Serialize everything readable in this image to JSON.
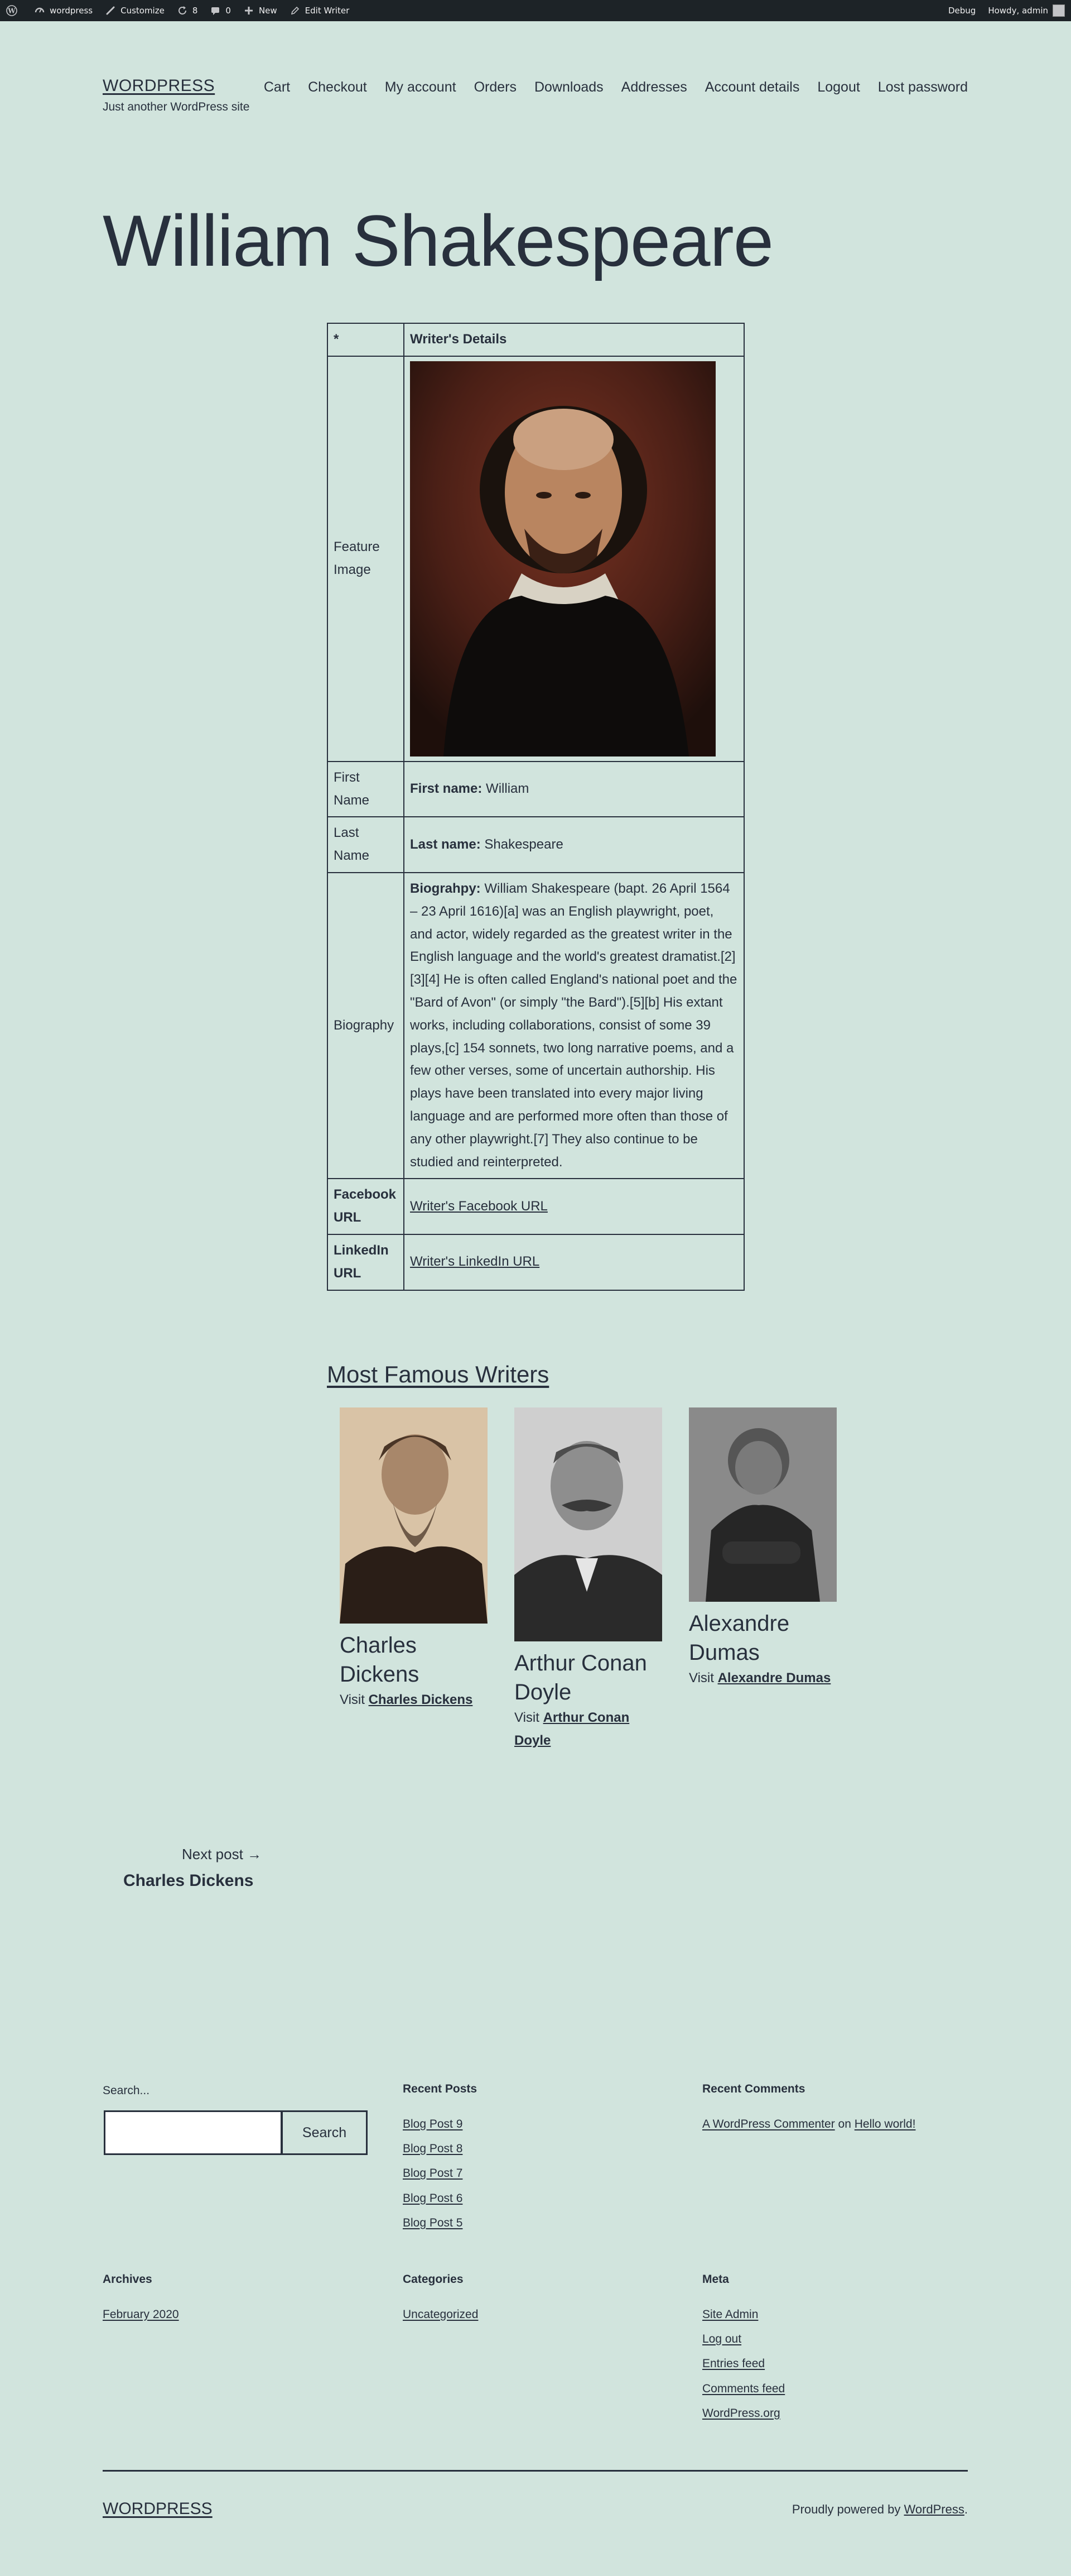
{
  "admin_bar": {
    "site": "wordpress",
    "customize": "Customize",
    "updates": "8",
    "comments": "0",
    "new": "New",
    "edit": "Edit Writer",
    "debug": "Debug",
    "howdy": "Howdy, admin"
  },
  "header": {
    "site_title": "WORDPRESS",
    "tagline": "Just another WordPress site",
    "nav": [
      "Cart",
      "Checkout",
      "My account",
      "Orders",
      "Downloads",
      "Addresses",
      "Account details",
      "Logout",
      "Lost password"
    ]
  },
  "post": {
    "title": "William Shakespeare"
  },
  "writer_table": {
    "header_col1": "*",
    "header_col2": "Writer's Details",
    "feature_image_label": "Feature Image",
    "first_name_label": "First Name",
    "first_name_key": "First name:",
    "first_name_value": "William",
    "last_name_label": "Last Name",
    "last_name_key": "Last name:",
    "last_name_value": "Shakespeare",
    "biography_label": "Biography",
    "biography_key": "Biograhpy:",
    "biography_value": "William Shakespeare (bapt. 26 April 1564 – 23 April 1616)[a] was an English playwright, poet, and actor, widely regarded as the greatest writer in the English language and the world's greatest dramatist.[2][3][4] He is often called England's national poet and the \"Bard of Avon\" (or simply \"the Bard\").[5][b] His extant works, including collaborations, consist of some 39 plays,[c] 154 sonnets, two long narrative poems, and a few other verses, some of uncertain authorship. His plays have been translated into every major living language and are performed more often than those of any other playwright.[7] They also continue to be studied and reinterpreted.",
    "facebook_label": "Facebook URL",
    "facebook_link": "Writer's Facebook URL",
    "linkedin_label": "LinkedIn URL",
    "linkedin_link": "Writer's LinkedIn URL"
  },
  "famous": {
    "heading": "Most Famous Writers",
    "visit_prefix": "Visit",
    "writers": [
      {
        "name": "Charles Dickens",
        "link": "Charles Dickens"
      },
      {
        "name": "Arthur Conan Doyle",
        "link": "Arthur Conan Doyle"
      },
      {
        "name": "Alexandre Dumas",
        "link": "Alexandre Dumas"
      }
    ]
  },
  "post_nav": {
    "next_label": "Next post →",
    "next_title": "Charles Dickens"
  },
  "widgets": {
    "search_label": "Search...",
    "search_button": "Search",
    "recent_posts_title": "Recent Posts",
    "recent_posts": [
      "Blog Post 9",
      "Blog Post 8",
      "Blog Post 7",
      "Blog Post 6",
      "Blog Post 5"
    ],
    "recent_comments_title": "Recent Comments",
    "comment_author": "A WordPress Commenter",
    "comment_on": "on",
    "comment_post": "Hello world!",
    "archives_title": "Archives",
    "archives": [
      "February 2020"
    ],
    "categories_title": "Categories",
    "categories": [
      "Uncategorized"
    ],
    "meta_title": "Meta",
    "meta": [
      "Site Admin",
      "Log out",
      "Entries feed",
      "Comments feed",
      "WordPress.org"
    ]
  },
  "footer": {
    "site_title": "WORDPRESS",
    "powered_prefix": "Proudly powered by ",
    "powered_link": "WordPress",
    "powered_suffix": "."
  }
}
